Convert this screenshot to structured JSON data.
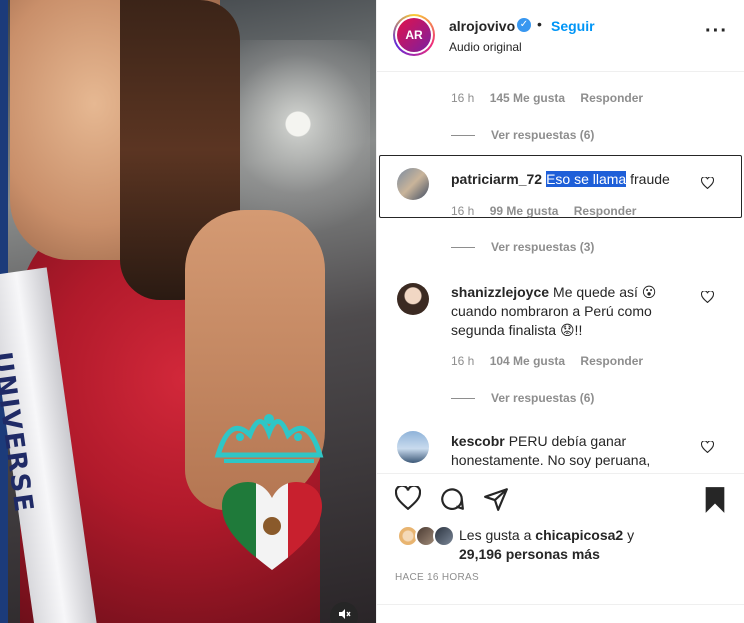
{
  "header": {
    "avatar_text": "AR",
    "username": "alrojovivo",
    "verified_icon": "verified-badge-icon",
    "separator": "•",
    "follow_label": "Seguir",
    "subtitle": "Audio original",
    "more_icon": "more-options-icon"
  },
  "comments": [
    {
      "username": "",
      "text": "",
      "time": "16 h",
      "likes": "145 Me gusta",
      "reply": "Responder",
      "view_replies": "Ver respuestas (6)"
    },
    {
      "username": "patriciarm_72",
      "text_highlight": "Eso se llama",
      "text_rest": "fraude",
      "time": "16 h",
      "likes": "99 Me gusta",
      "reply": "Responder",
      "view_replies": "Ver respuestas (3)"
    },
    {
      "username": "shanizzlejoyce",
      "text_line1": "Me quede así 😮",
      "text_line2": "cuando nombraron a Perú como",
      "text_line3": "segunda finalista 😟!!",
      "time": "16 h",
      "likes": "104 Me gusta",
      "reply": "Responder",
      "view_replies": "Ver respuestas (6)"
    },
    {
      "username": "kescobr",
      "text_line1": "PERU debía ganar",
      "text_line2": "honestamente. No soy peruana,"
    }
  ],
  "actions": {
    "like_icon": "heart-icon",
    "comment_icon": "comment-icon",
    "share_icon": "share-icon",
    "save_icon": "bookmark-icon"
  },
  "likes": {
    "prefix": "Les gusta a",
    "user": "chicapicosa2",
    "conj": "y",
    "count": "29,196 personas más"
  },
  "timestamp": "HACE 16 HORAS",
  "media": {
    "sash_text": "UNIVERSE",
    "mute_icon": "muted-speaker-icon"
  },
  "colors": {
    "accent": "#0095f6",
    "highlight": "#1e5fd8",
    "muted_text": "#8e8e8e"
  }
}
